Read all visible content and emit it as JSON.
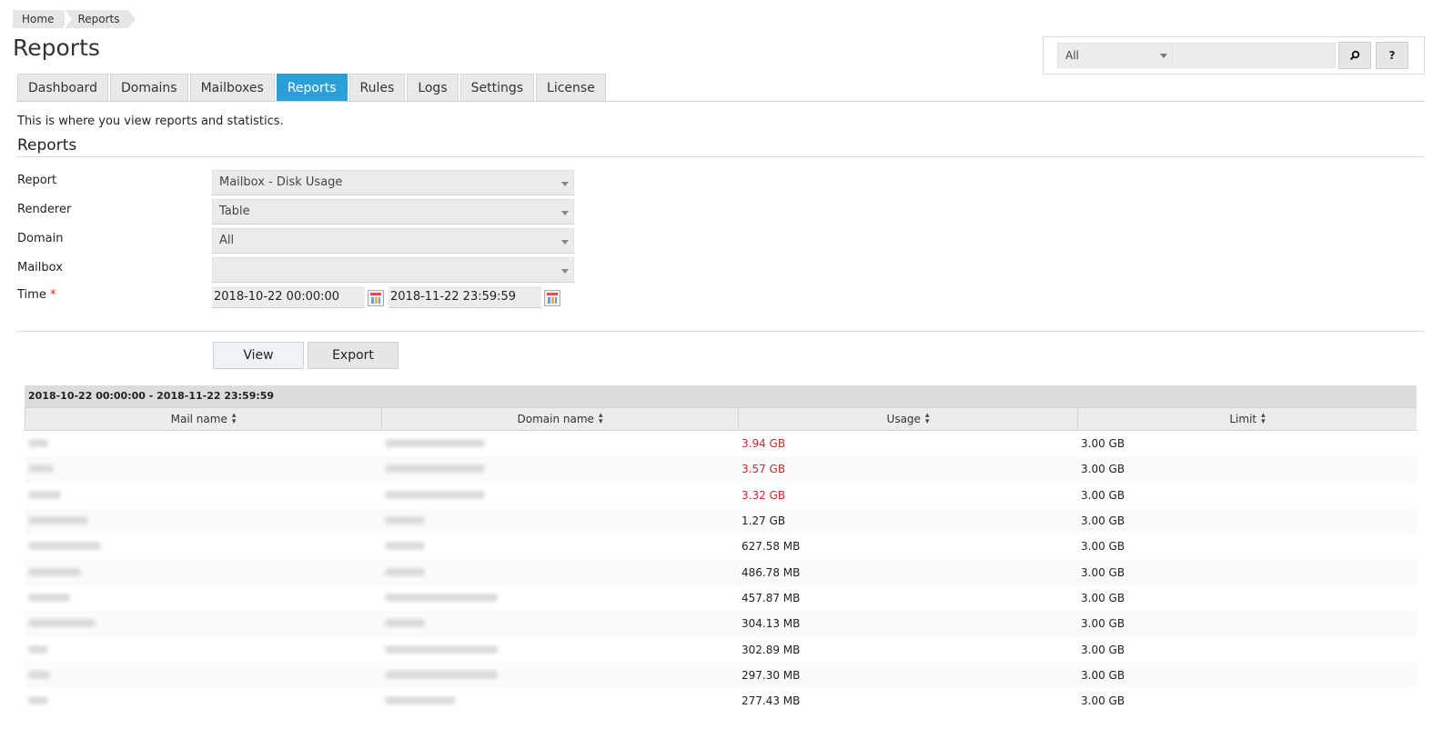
{
  "breadcrumb": [
    "Home",
    "Reports"
  ],
  "page_title": "Reports",
  "search": {
    "scope": "All",
    "value": "",
    "search_icon": "magnifier-icon",
    "help_label": "?"
  },
  "tabs": [
    {
      "label": "Dashboard",
      "active": false
    },
    {
      "label": "Domains",
      "active": false
    },
    {
      "label": "Mailboxes",
      "active": false
    },
    {
      "label": "Reports",
      "active": true
    },
    {
      "label": "Rules",
      "active": false
    },
    {
      "label": "Logs",
      "active": false
    },
    {
      "label": "Settings",
      "active": false
    },
    {
      "label": "License",
      "active": false
    }
  ],
  "intro_text": "This is where you view reports and statistics.",
  "section_title": "Reports",
  "form": {
    "report_label": "Report",
    "report_value": "Mailbox - Disk Usage",
    "renderer_label": "Renderer",
    "renderer_value": "Table",
    "domain_label": "Domain",
    "domain_value": "All",
    "mailbox_label": "Mailbox",
    "mailbox_value": "",
    "time_label": "Time",
    "time_required": "*",
    "time_from": "2018-10-22 00:00:00",
    "time_to": "2018-11-22 23:59:59"
  },
  "buttons": {
    "view": "View",
    "export": "Export"
  },
  "table": {
    "caption": "2018-10-22 00:00:00 - 2018-11-22 23:59:59",
    "columns": [
      "Mail name",
      "Domain name",
      "Usage",
      "Limit"
    ],
    "rows": [
      {
        "usage": "3.94 GB",
        "limit": "3.00 GB",
        "over": true
      },
      {
        "usage": "3.57 GB",
        "limit": "3.00 GB",
        "over": true
      },
      {
        "usage": "3.32 GB",
        "limit": "3.00 GB",
        "over": true
      },
      {
        "usage": "1.27 GB",
        "limit": "3.00 GB",
        "over": false
      },
      {
        "usage": "627.58 MB",
        "limit": "3.00 GB",
        "over": false
      },
      {
        "usage": "486.78 MB",
        "limit": "3.00 GB",
        "over": false
      },
      {
        "usage": "457.87 MB",
        "limit": "3.00 GB",
        "over": false
      },
      {
        "usage": "304.13 MB",
        "limit": "3.00 GB",
        "over": false
      },
      {
        "usage": "302.89 MB",
        "limit": "3.00 GB",
        "over": false
      },
      {
        "usage": "297.30 MB",
        "limit": "3.00 GB",
        "over": false
      },
      {
        "usage": "277.43 MB",
        "limit": "3.00 GB",
        "over": false
      }
    ]
  },
  "colors": {
    "accent": "#2b9fd8",
    "over_limit": "#d9242b"
  }
}
